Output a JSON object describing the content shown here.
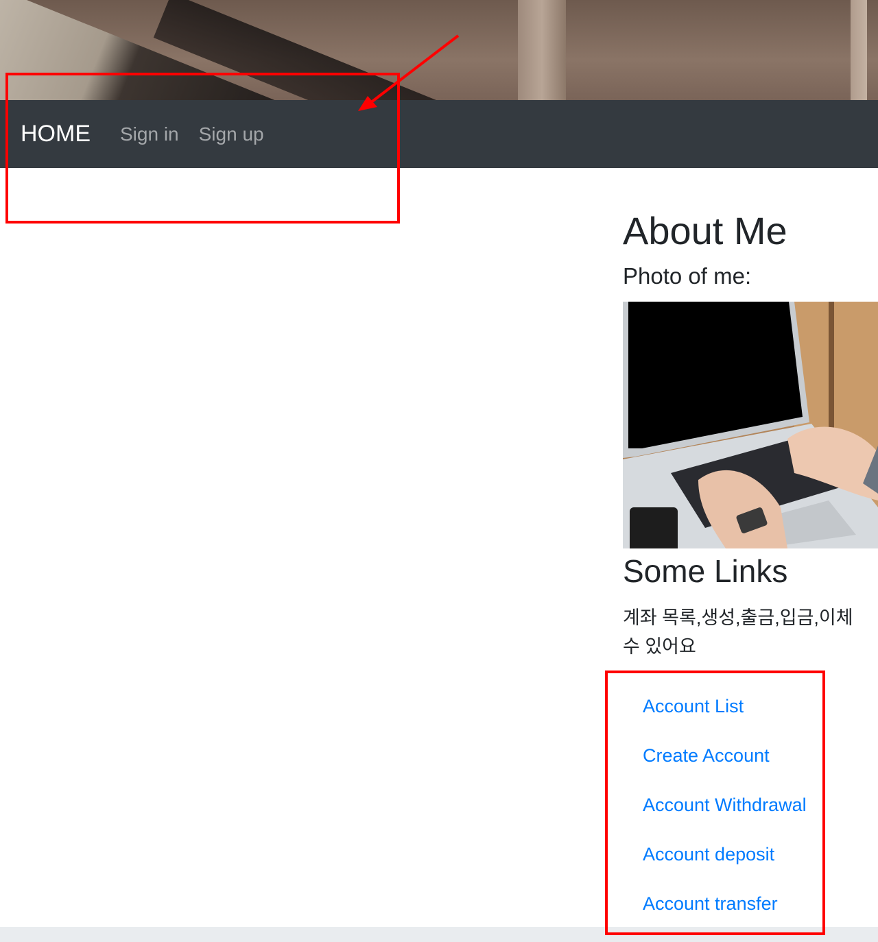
{
  "navbar": {
    "brand": "HOME",
    "items": [
      {
        "label": "Sign in"
      },
      {
        "label": "Sign up"
      }
    ]
  },
  "about": {
    "heading": "About Me",
    "photo_label": "Photo of me:"
  },
  "links_section": {
    "heading": "Some Links",
    "description": "계좌 목록,생성,출금,입금,이체\n수 있어요",
    "links": [
      {
        "label": "Account List"
      },
      {
        "label": "Create Account"
      },
      {
        "label": "Account Withdrawal"
      },
      {
        "label": "Account deposit"
      },
      {
        "label": "Account transfer"
      }
    ]
  },
  "colors": {
    "navbar_bg": "#343a40",
    "link": "#007bff",
    "annotation": "#ff0000"
  }
}
